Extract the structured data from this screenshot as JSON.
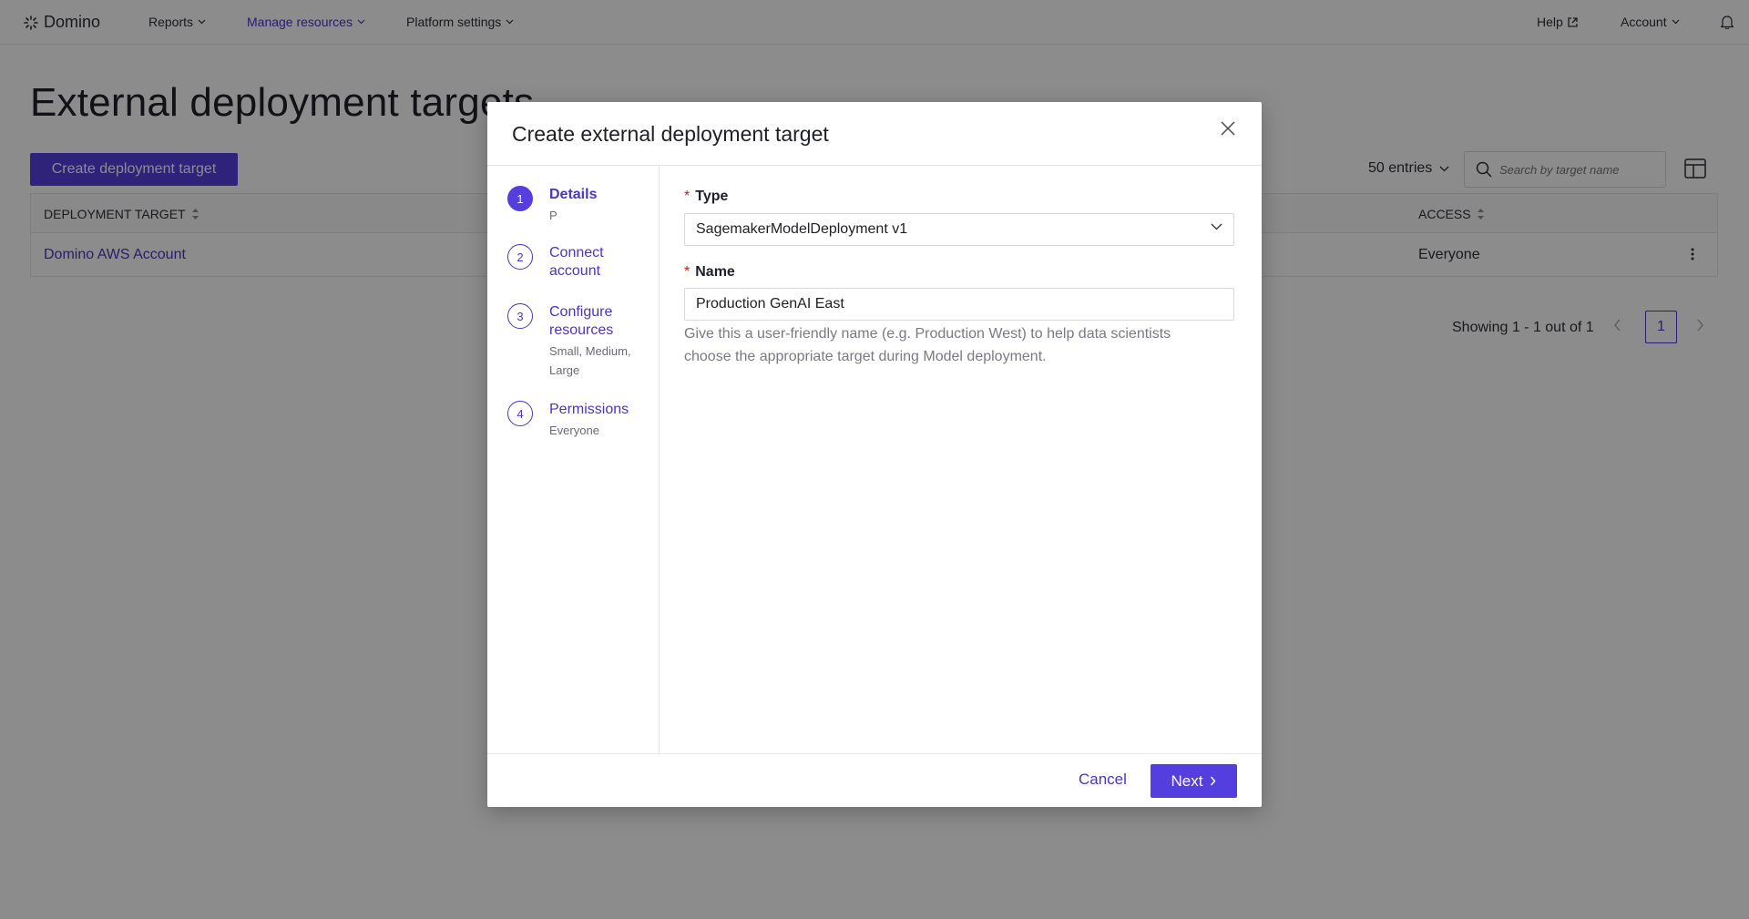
{
  "nav": {
    "brand": "Domino",
    "items": [
      {
        "label": "Reports"
      },
      {
        "label": "Manage resources"
      },
      {
        "label": "Platform settings"
      }
    ],
    "help": "Help",
    "account": "Account"
  },
  "page": {
    "title": "External deployment targets",
    "create_button": "Create deployment target",
    "entries_label": "50 entries",
    "search_placeholder": "Search by target name",
    "table": {
      "columns": [
        "DEPLOYMENT TARGET",
        "ACCESS"
      ],
      "rows": [
        {
          "target": "Domino AWS Account",
          "access": "Everyone"
        }
      ]
    },
    "pagination": {
      "summary": "Showing 1 - 1 out of 1",
      "current_page": "1"
    }
  },
  "modal": {
    "title": "Create external deployment target",
    "steps": [
      {
        "number": "1",
        "title": "Details",
        "subtitle": "P",
        "active": true
      },
      {
        "number": "2",
        "title": "Connect account",
        "subtitle": ""
      },
      {
        "number": "3",
        "title": "Configure resources",
        "subtitle": "Small, Medium, Large"
      },
      {
        "number": "4",
        "title": "Permissions",
        "subtitle": "Everyone"
      }
    ],
    "form": {
      "type_label": "Type",
      "type_value": "SagemakerModelDeployment v1",
      "name_label": "Name",
      "name_value": "Production GenAI East",
      "name_help": "Give this a user-friendly name (e.g. Production West) to help data scientists choose the appropriate target during Model deployment.",
      "required_mark": "*"
    },
    "footer": {
      "cancel": "Cancel",
      "next": "Next"
    }
  },
  "colors": {
    "accent": "#543fde",
    "link": "#4a35c9",
    "required": "#c5221f",
    "overlay": "rgba(0,0,0,0.45)"
  }
}
